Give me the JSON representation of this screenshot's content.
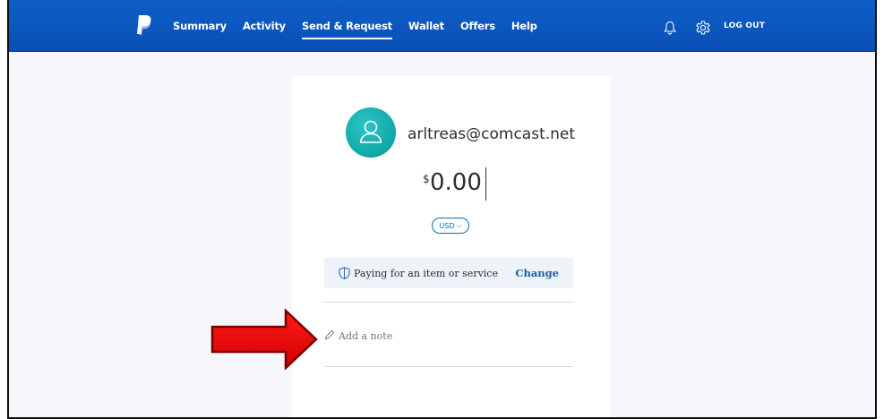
{
  "nav": {
    "items": [
      {
        "label": "Summary",
        "active": false
      },
      {
        "label": "Activity",
        "active": false
      },
      {
        "label": "Send & Request",
        "active": true
      },
      {
        "label": "Wallet",
        "active": false
      },
      {
        "label": "Offers",
        "active": false
      },
      {
        "label": "Help",
        "active": false
      }
    ],
    "logout_label": "LOG OUT"
  },
  "icons": {
    "logo": "paypal-logo-icon",
    "notifications": "bell-icon",
    "settings": "gear-icon",
    "avatar": "user-icon",
    "purpose": "shield-icon",
    "note": "pencil-icon",
    "pointer": "red-arrow-icon"
  },
  "recipient": {
    "email": "arltreas@comcast.net"
  },
  "payment": {
    "currency_symbol": "$",
    "amount": "0.00",
    "currency_code": "USD"
  },
  "purpose": {
    "label": "Paying for an item or service",
    "change_label": "Change"
  },
  "note": {
    "placeholder": "Add a note"
  },
  "colors": {
    "header": "#0a4fb5",
    "avatar": "#10a7a8",
    "link": "#0070ba",
    "arrow": "#e00000"
  }
}
